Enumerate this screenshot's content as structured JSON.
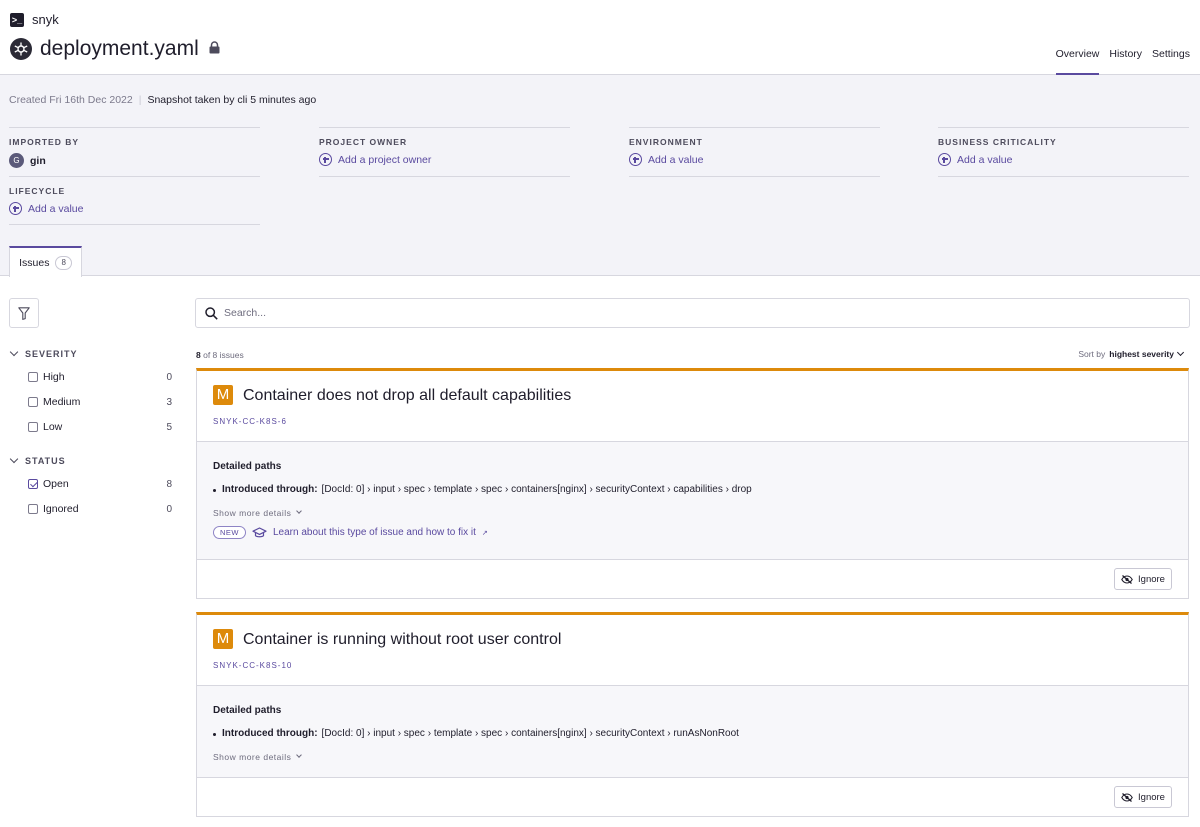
{
  "org": {
    "name": "snyk",
    "icon": "terminal-icon"
  },
  "project": {
    "title": "deployment.yaml",
    "icon": "kubernetes-icon",
    "lock_icon": "lock-icon"
  },
  "nav": {
    "tabs": [
      "Overview",
      "History",
      "Settings"
    ],
    "active": "Overview"
  },
  "meta": {
    "created": "Created Fri 16th Dec 2022",
    "separator": "|",
    "snapshot": "Snapshot taken by cli 5 minutes ago"
  },
  "attributes": {
    "imported_by": {
      "label": "IMPORTED BY",
      "avatar": "G",
      "value": "gin"
    },
    "project_owner": {
      "label": "PROJECT OWNER",
      "value": "Add a project owner"
    },
    "environment": {
      "label": "ENVIRONMENT",
      "value": "Add a value"
    },
    "business_criticality": {
      "label": "BUSINESS CRITICALITY",
      "value": "Add a value"
    },
    "lifecycle": {
      "label": "LIFECYCLE",
      "value": "Add a value"
    }
  },
  "issues_tab": {
    "label": "Issues",
    "count": "8"
  },
  "filters": {
    "severity": {
      "title": "SEVERITY",
      "items": [
        {
          "label": "High",
          "count": "0",
          "checked": false
        },
        {
          "label": "Medium",
          "count": "3",
          "checked": false
        },
        {
          "label": "Low",
          "count": "5",
          "checked": false
        }
      ]
    },
    "status": {
      "title": "STATUS",
      "items": [
        {
          "label": "Open",
          "count": "8",
          "checked": true
        },
        {
          "label": "Ignored",
          "count": "0",
          "checked": false
        }
      ]
    }
  },
  "search": {
    "placeholder": "Search..."
  },
  "results": {
    "shown": "8",
    "suffix": "of 8 issues",
    "sort_prefix": "Sort by",
    "sort_value": "highest severity"
  },
  "issues": [
    {
      "severity": "M",
      "severity_color": "#dd8a0b",
      "title": "Container does not drop all default capabilities",
      "id": "SNYK-CC-K8S-6",
      "paths_title": "Detailed paths",
      "introduced_label": "Introduced through:",
      "path": "[DocId: 0] › input › spec › template › spec › containers[nginx] › securityContext › capabilities › drop",
      "show_more": "Show more details",
      "badge": "NEW",
      "learn": "Learn about this type of issue and how to fix it",
      "ignore": "Ignore"
    },
    {
      "severity": "M",
      "severity_color": "#dd8a0b",
      "title": "Container is running without root user control",
      "id": "SNYK-CC-K8S-10",
      "paths_title": "Detailed paths",
      "introduced_label": "Introduced through:",
      "path": "[DocId: 0] › input › spec › template › spec › containers[nginx] › securityContext › runAsNonRoot",
      "show_more": "Show more details",
      "ignore": "Ignore"
    }
  ],
  "colors": {
    "accent": "#5a4a9f",
    "medium": "#dd8a0b",
    "band": "#f3f3f8"
  }
}
